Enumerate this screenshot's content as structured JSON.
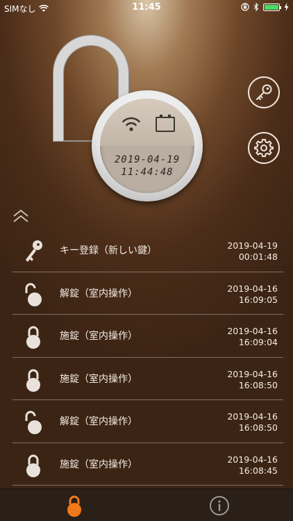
{
  "status_bar": {
    "carrier": "SIMなし",
    "time": "11:45",
    "battery_color": "#4cd964"
  },
  "lock": {
    "state": "unlocked",
    "display_date": "2019-04-19",
    "display_time": "11:44:48",
    "icons": [
      "wifi-icon",
      "battery-icon"
    ]
  },
  "buttons": {
    "key": "key-icon",
    "settings": "gear-icon"
  },
  "history": [
    {
      "icon": "key-icon",
      "label": "キー登録（新しい鍵）",
      "date": "2019-04-19",
      "time": "00:01:48"
    },
    {
      "icon": "unlocked-icon",
      "label": "解錠（室内操作）",
      "date": "2019-04-16",
      "time": "16:09:05"
    },
    {
      "icon": "locked-icon",
      "label": "施錠（室内操作）",
      "date": "2019-04-16",
      "time": "16:09:04"
    },
    {
      "icon": "locked-icon",
      "label": "施錠（室内操作）",
      "date": "2019-04-16",
      "time": "16:08:50"
    },
    {
      "icon": "unlocked-icon",
      "label": "解錠（室内操作）",
      "date": "2019-04-16",
      "time": "16:08:50"
    },
    {
      "icon": "locked-icon",
      "label": "施錠（室内操作）",
      "date": "2019-04-16",
      "time": "16:08:45"
    }
  ],
  "tab_bar": {
    "active_color": "#f07a1a",
    "inactive_color": "#9a9a9a",
    "tabs": [
      "lock-tab",
      "info-tab"
    ]
  }
}
